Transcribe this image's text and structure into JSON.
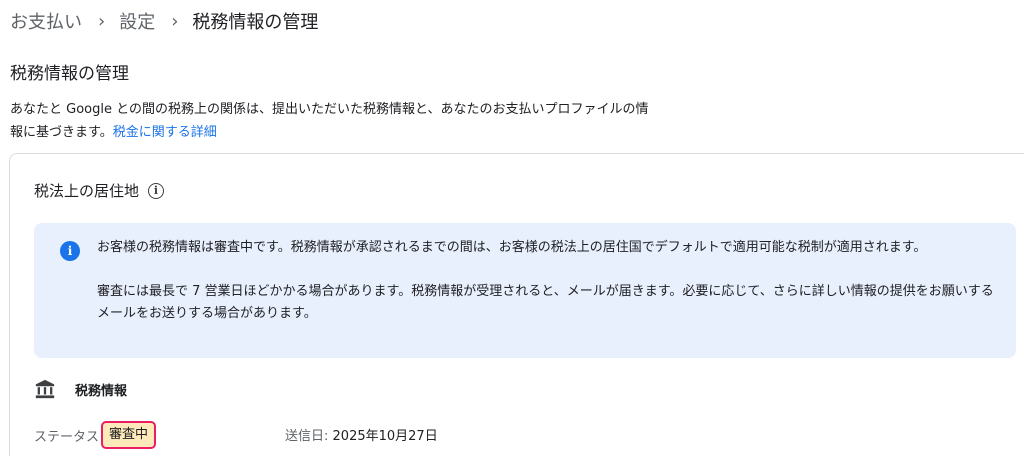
{
  "breadcrumb": {
    "items": [
      "お支払い",
      "設定",
      "税務情報の管理"
    ],
    "separator": "›"
  },
  "page_title": "税務情報の管理",
  "description": {
    "text": "あなたと Google との間の税務上の関係は、提出いただいた税務情報と、あなたのお支払いプロファイルの情報に基づきます。",
    "link": "税金に関する詳細"
  },
  "residency": {
    "title": "税法上の居住地",
    "info_icon": "info-outline-icon"
  },
  "alert": {
    "icon": "info-filled-icon",
    "color": "#1a73e8",
    "background": "#e8f0fe",
    "paragraph1": "お客様の税務情報は審査中です。税務情報が承認されるまでの間は、お客様の税法上の居住国でデフォルトで適用可能な税制が適用されます。",
    "paragraph2": "審査には最長で 7 営業日ほどかかる場合があります。税務情報が受理されると、メールが届きます。必要に応じて、さらに詳しい情報の提供をお願いするメールをお送りする場合があります。"
  },
  "tax_info": {
    "icon": "bank-icon",
    "title": "税務情報",
    "status_label": "ステータス",
    "status_value": "審査中",
    "status_color": "#fde9b9",
    "highlight_color": "#e91e63",
    "sent_date_label": "送信日:",
    "sent_date_value": "2025年10月27日"
  }
}
